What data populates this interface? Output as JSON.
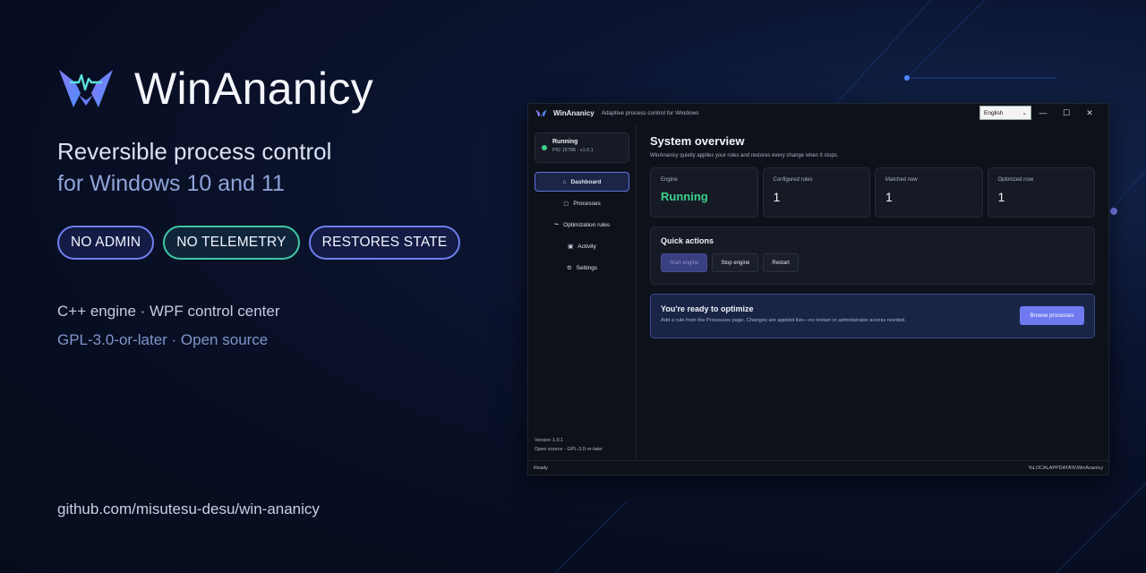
{
  "hero": {
    "title": "WinAnanicy",
    "tagline_line1": "Reversible process control",
    "tagline_line2": "for Windows 10 and 11",
    "chips": [
      "NO ADMIN",
      "NO TELEMETRY",
      "RESTORES STATE"
    ],
    "tech_line1": "C++ engine  ·  WPF control center",
    "tech_line2": "GPL-3.0-or-later  ·  Open source",
    "repo": "github.com/misutesu-desu/win-ananicy",
    "logo_icon": "w-heartbeat-logo-icon"
  },
  "window": {
    "app_name": "WinAnanicy",
    "subtitle": "Adaptive process control for Windows",
    "language": "English",
    "controls": {
      "minimize": "—",
      "maximize": "☐",
      "close": "✕"
    },
    "status": {
      "title": "Running",
      "pid": "PID 15788 · v1.0.1"
    },
    "nav": [
      {
        "label": "Dashboard",
        "icon": "⌂",
        "icon_name": "home-icon"
      },
      {
        "label": "Processes",
        "icon": "▢",
        "icon_name": "square-icon"
      },
      {
        "label": "Optimization rules",
        "icon": "⏦",
        "icon_name": "rules-icon"
      },
      {
        "label": "Activity",
        "icon": "▣",
        "icon_name": "activity-icon"
      },
      {
        "label": "Settings",
        "icon": "⚙",
        "icon_name": "gear-icon"
      }
    ],
    "sidebar_footer": {
      "version": "Version 1.0.1",
      "license": "Open source · GPL-3.0-or-later"
    },
    "main": {
      "title": "System overview",
      "description": "WinAnanicy quietly applies your rules and restores every change when it stops.",
      "stats": [
        {
          "label": "Engine",
          "value": "Running"
        },
        {
          "label": "Configured rules",
          "value": "1"
        },
        {
          "label": "Matched now",
          "value": "1"
        },
        {
          "label": "Optimized now",
          "value": "1"
        }
      ],
      "quick_actions": {
        "title": "Quick actions",
        "buttons": [
          "Start engine",
          "Stop engine",
          "Restart"
        ]
      },
      "cta": {
        "title": "You're ready to optimize",
        "description": "Add a rule from the Processes page. Changes are applied live—no restart or administrator access needed.",
        "button": "Browse processes"
      }
    },
    "statusbar": {
      "left": "Ready",
      "right": "%LOCALAPPDATA%\\WinAnanicy"
    }
  },
  "colors": {
    "accent": "#6f7af0",
    "running_green": "#3ecf8e",
    "chip_green_border": "#3ec9a3",
    "chip_blue_border": "#6e7ff0"
  }
}
